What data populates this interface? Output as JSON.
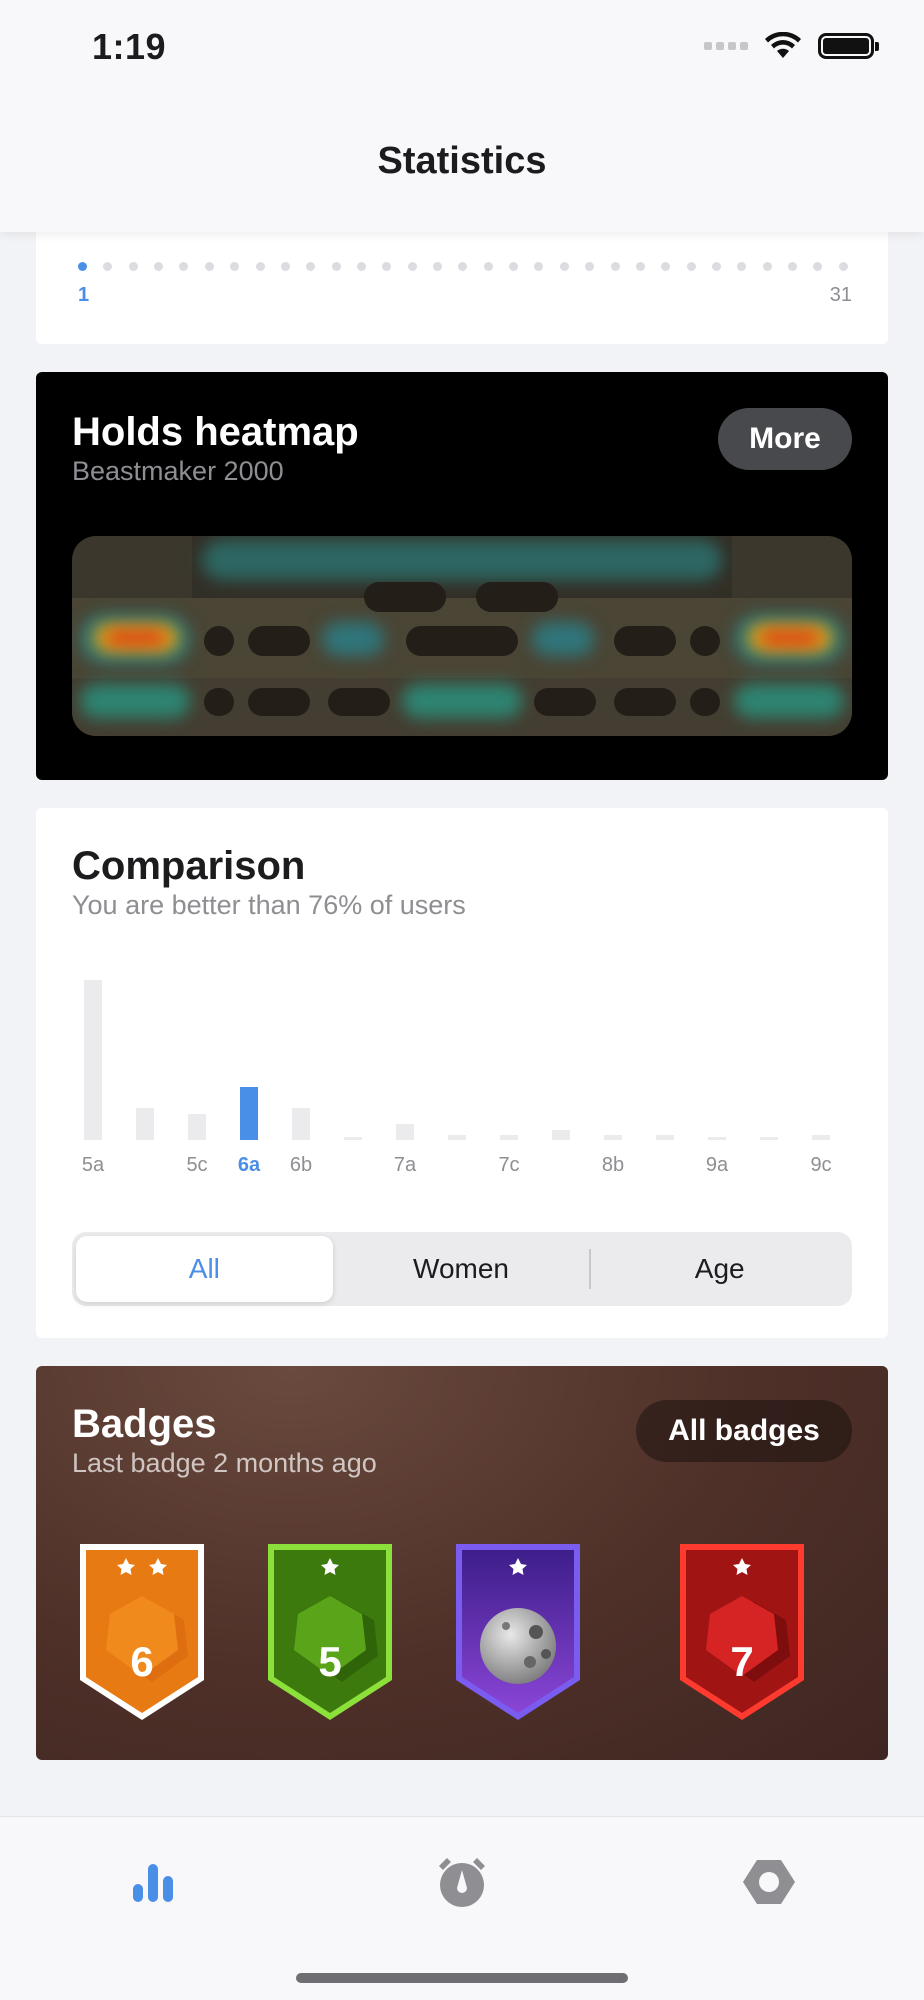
{
  "status_bar": {
    "time": "1:19"
  },
  "header": {
    "title": "Statistics"
  },
  "calendar": {
    "start_label": "1",
    "end_label": "31",
    "days": 31,
    "active_day": 1
  },
  "heatmap": {
    "title": "Holds heatmap",
    "subtitle": "Beastmaker 2000",
    "more_label": "More"
  },
  "comparison": {
    "title": "Comparison",
    "subtitle": "You are better than 76% of users",
    "segments": [
      "All",
      "Women",
      "Age"
    ],
    "active_segment": "All"
  },
  "chart_data": {
    "type": "bar",
    "categories": [
      "5a",
      "5b",
      "5c",
      "6a",
      "6b",
      "6c",
      "7a",
      "7b",
      "7c",
      "8a",
      "8b",
      "8c",
      "9a",
      "9b",
      "9c"
    ],
    "tick_labels": [
      "5a",
      "",
      "5c",
      "6a",
      "6b",
      "",
      "7a",
      "",
      "7c",
      "",
      "8b",
      "",
      "9a",
      "",
      "9c"
    ],
    "values": [
      100,
      20,
      16,
      33,
      20,
      2,
      10,
      3,
      3,
      6,
      3,
      3,
      2,
      2,
      3
    ],
    "highlight": "6a",
    "ylim": [
      0,
      100
    ],
    "colors": {
      "bar": "#ebebed",
      "highlight": "#4a8fe7"
    }
  },
  "badges": {
    "title": "Badges",
    "subtitle": "Last badge 2 months ago",
    "all_label": "All badges",
    "items": [
      {
        "number": "6",
        "stars": 2,
        "color": "#f08a1c",
        "dark": "#d9660f",
        "border": "#ffffff"
      },
      {
        "number": "5",
        "stars": 1,
        "color": "#5aa41a",
        "dark": "#3d7a0e",
        "border": "#8be03a"
      },
      {
        "number": "",
        "stars": 1,
        "color": "#6a38c9",
        "dark": "#3d1e8a",
        "border": "#7b5cf0",
        "icon": "moon-icon"
      },
      {
        "number": "7",
        "stars": 1,
        "color": "#d62424",
        "dark": "#a11414",
        "border": "#ff3b30"
      }
    ]
  },
  "tabbar": {
    "tabs": [
      {
        "icon": "bar-chart-icon",
        "active": true
      },
      {
        "icon": "stopwatch-icon",
        "active": false
      },
      {
        "icon": "hexagon-settings-icon",
        "active": false
      }
    ],
    "active_color": "#4a8fe7",
    "inactive_color": "#8e8e93"
  }
}
